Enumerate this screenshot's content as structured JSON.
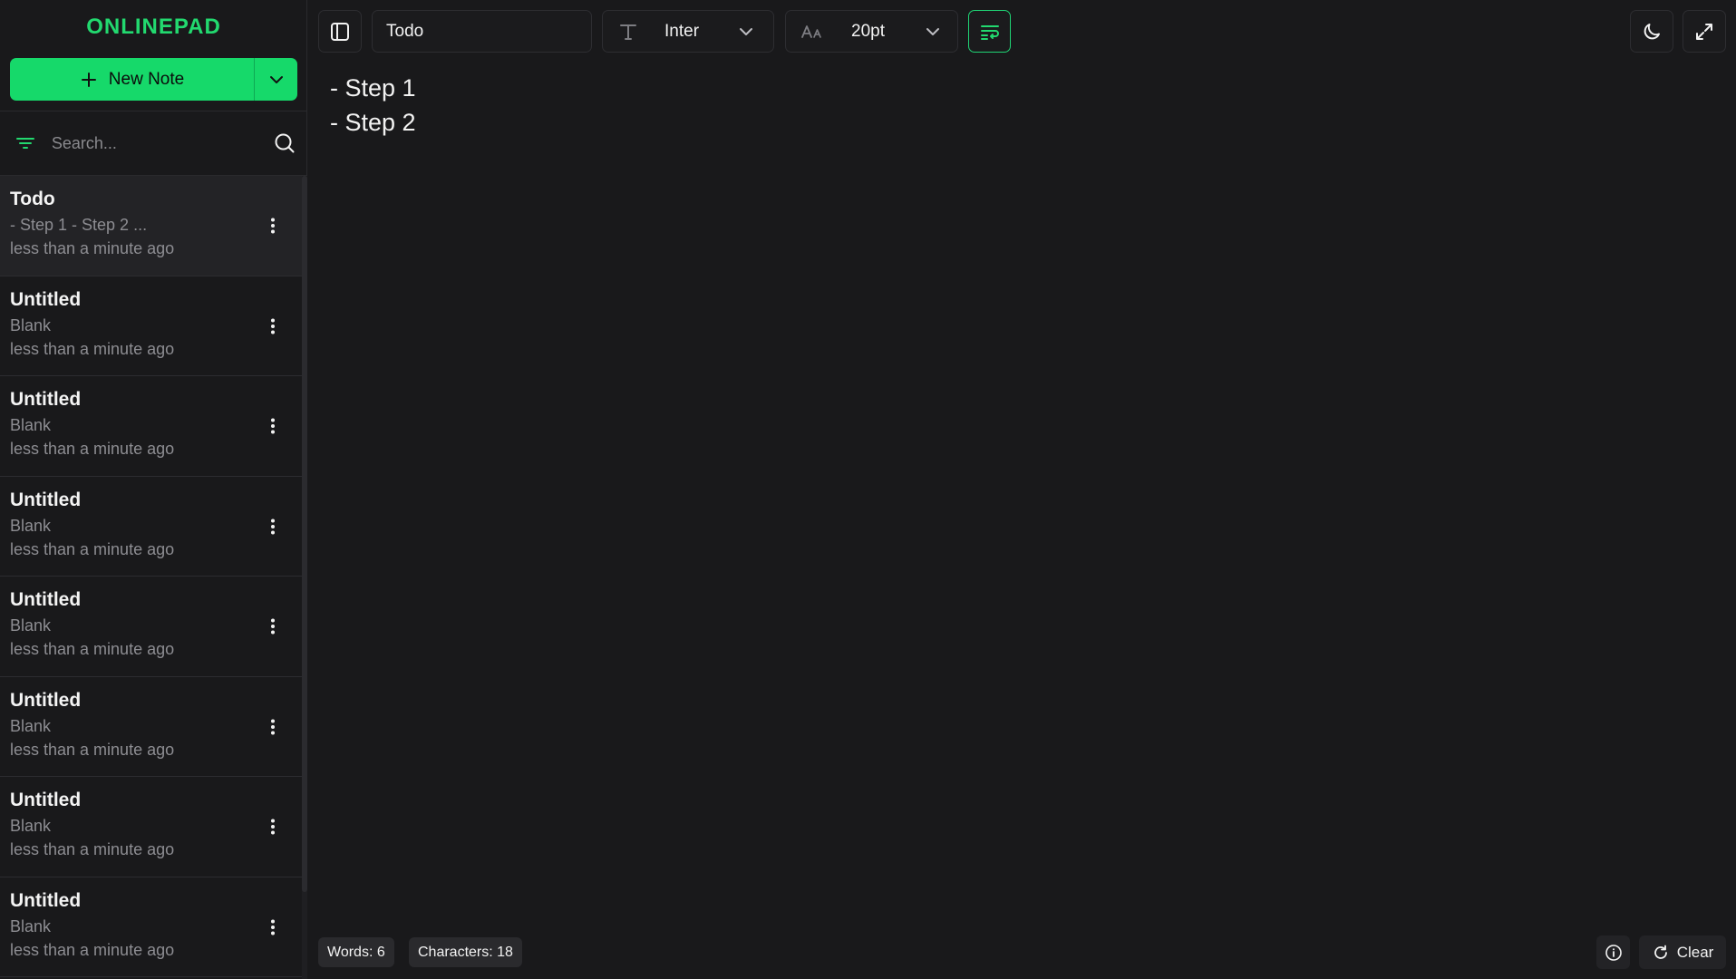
{
  "app": {
    "logo": "ONLINEPAD",
    "accent": "#16d96a"
  },
  "sidebar": {
    "new_note_label": "New Note",
    "search_placeholder": "Search...",
    "notes": [
      {
        "title": "Todo",
        "preview": "- Step 1 - Step 2 ...",
        "time": "less than a minute ago",
        "active": true
      },
      {
        "title": "Untitled",
        "preview": "Blank",
        "time": "less than a minute ago"
      },
      {
        "title": "Untitled",
        "preview": "Blank",
        "time": "less than a minute ago"
      },
      {
        "title": "Untitled",
        "preview": "Blank",
        "time": "less than a minute ago"
      },
      {
        "title": "Untitled",
        "preview": "Blank",
        "time": "less than a minute ago"
      },
      {
        "title": "Untitled",
        "preview": "Blank",
        "time": "less than a minute ago"
      },
      {
        "title": "Untitled",
        "preview": "Blank",
        "time": "less than a minute ago"
      },
      {
        "title": "Untitled",
        "preview": "Blank",
        "time": "less than a minute ago"
      }
    ]
  },
  "toolbar": {
    "note_title": "Todo",
    "font_label": "Inter",
    "size_label": "20pt"
  },
  "editor": {
    "lines": [
      "- Step 1",
      "- Step 2"
    ]
  },
  "footer": {
    "words": "Words: 6",
    "characters": "Characters: 18",
    "clear_label": "Clear"
  }
}
